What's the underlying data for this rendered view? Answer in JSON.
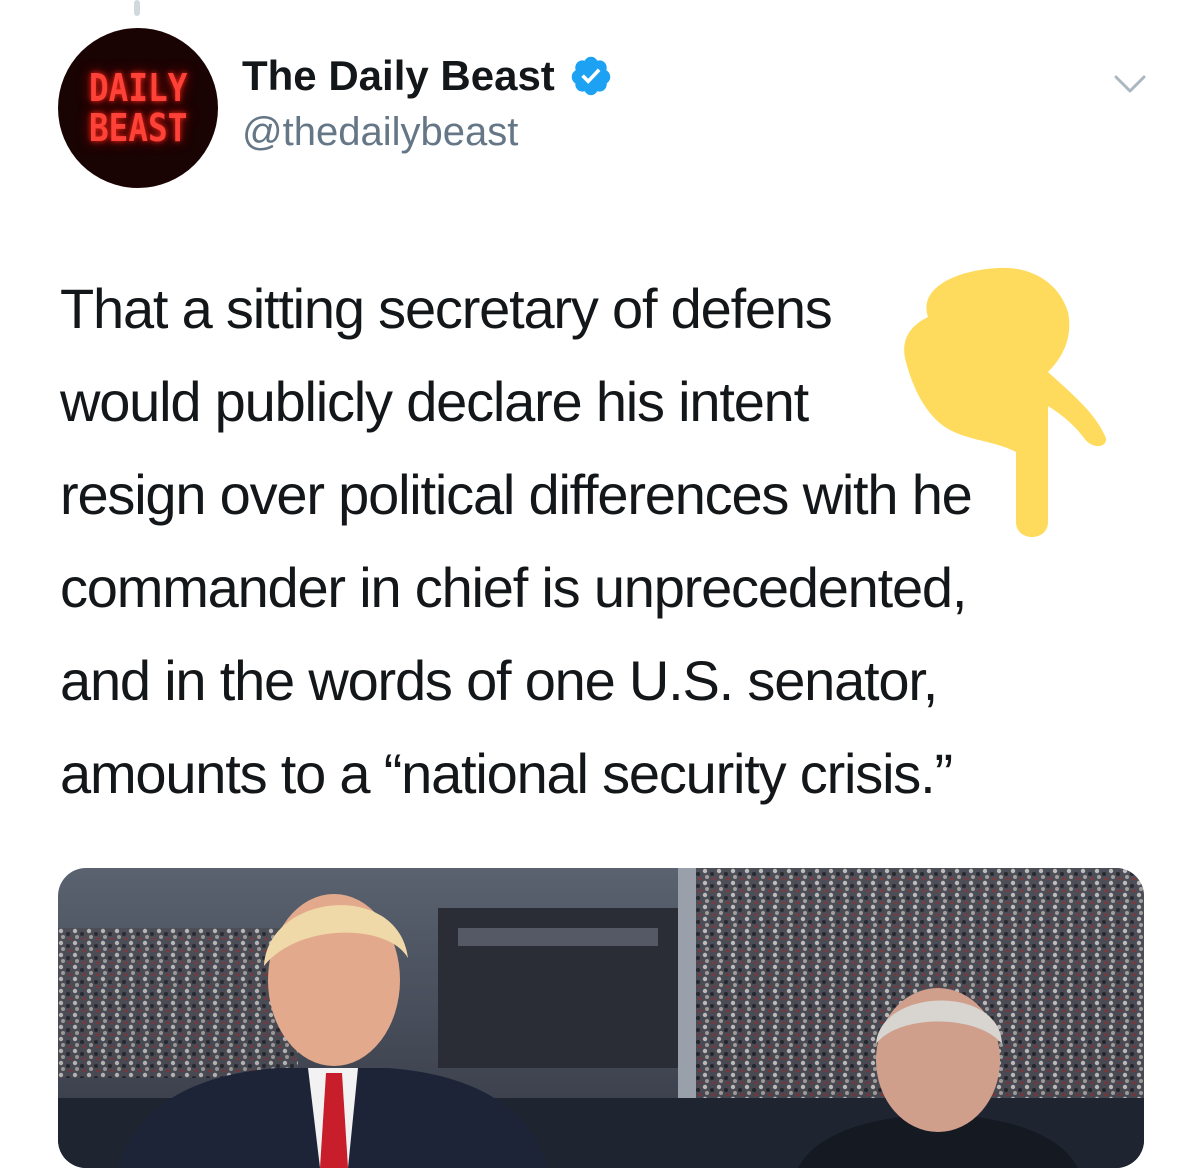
{
  "tweet": {
    "display_name": "The Daily Beast",
    "handle": "@thedailybeast",
    "avatar": {
      "line1": "DAILY",
      "line2": "BEAST"
    },
    "text_lines": [
      "That a sitting secretary of defens",
      "would publicly declare his intent",
      "resign over political differences with  he",
      "commander in chief is unprecedented,",
      "and in the words of one U.S. senator,",
      "amounts to a “national security crisis.”"
    ]
  },
  "colors": {
    "verified_badge": "#1da1f2",
    "avatar_text": "#ff4238",
    "emoji_yellow": "#fedb5c",
    "name_text": "#14171a",
    "handle_text": "#657786"
  },
  "icons": {
    "verified": "verified-badge-icon",
    "caret": "chevron-down-icon",
    "emoji": "pointing-down-finger-emoji"
  }
}
